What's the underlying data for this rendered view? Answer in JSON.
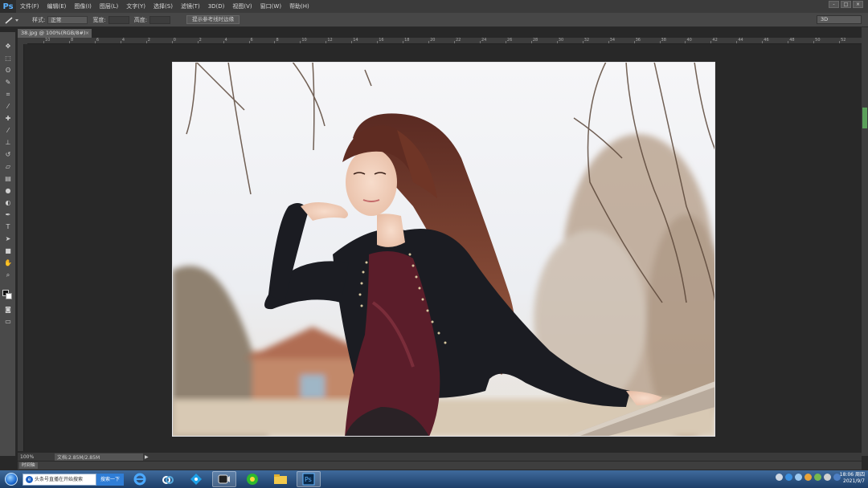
{
  "app": {
    "logo": "Ps"
  },
  "menu": [
    "文件(F)",
    "编辑(E)",
    "图像(I)",
    "图层(L)",
    "文字(Y)",
    "选择(S)",
    "滤镜(T)",
    "3D(D)",
    "视图(V)",
    "窗口(W)",
    "帮助(H)"
  ],
  "window_buttons": [
    "-",
    "□",
    "×"
  ],
  "options": {
    "style_label": "样式:",
    "style_value": "正常",
    "width_label": "宽度:",
    "height_label": "高度:",
    "refine_button": "提示参考线时边缘",
    "workspace": "3D"
  },
  "document": {
    "tab_title": "38.jpg @ 100%(RGB/8#)",
    "close": "×"
  },
  "ruler_labels": [
    "10",
    "8",
    "6",
    "4",
    "2",
    "0",
    "2",
    "4",
    "6",
    "8",
    "10",
    "12",
    "14",
    "16",
    "18",
    "20",
    "22",
    "24",
    "26",
    "28",
    "30",
    "32",
    "34",
    "36",
    "38",
    "40",
    "42",
    "44",
    "46",
    "48",
    "50",
    "52"
  ],
  "status": {
    "zoom": "100%",
    "doc": "文档:2.85M/2.85M",
    "arrow": "▶",
    "timeline": "时间轴"
  },
  "taskbar": {
    "search_text": "头条号直播在开始搜索",
    "search_button": "搜索一下",
    "clock_time": "18:06 周四",
    "clock_date": "2021/9/7"
  },
  "colors": {
    "accent": "#5cb2ff",
    "taskbar": "#2a5488"
  }
}
